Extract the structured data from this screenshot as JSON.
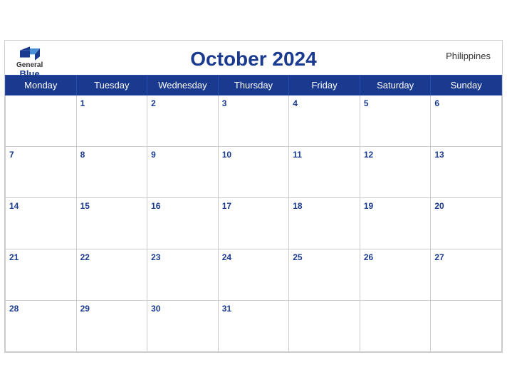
{
  "header": {
    "logo_general": "General",
    "logo_blue": "Blue",
    "month_title": "October 2024",
    "country": "Philippines"
  },
  "weekdays": [
    "Monday",
    "Tuesday",
    "Wednesday",
    "Thursday",
    "Friday",
    "Saturday",
    "Sunday"
  ],
  "weeks": [
    [
      "",
      "1",
      "2",
      "3",
      "4",
      "5",
      "6"
    ],
    [
      "7",
      "8",
      "9",
      "10",
      "11",
      "12",
      "13"
    ],
    [
      "14",
      "15",
      "16",
      "17",
      "18",
      "19",
      "20"
    ],
    [
      "21",
      "22",
      "23",
      "24",
      "25",
      "26",
      "27"
    ],
    [
      "28",
      "29",
      "30",
      "31",
      "",
      "",
      ""
    ]
  ]
}
